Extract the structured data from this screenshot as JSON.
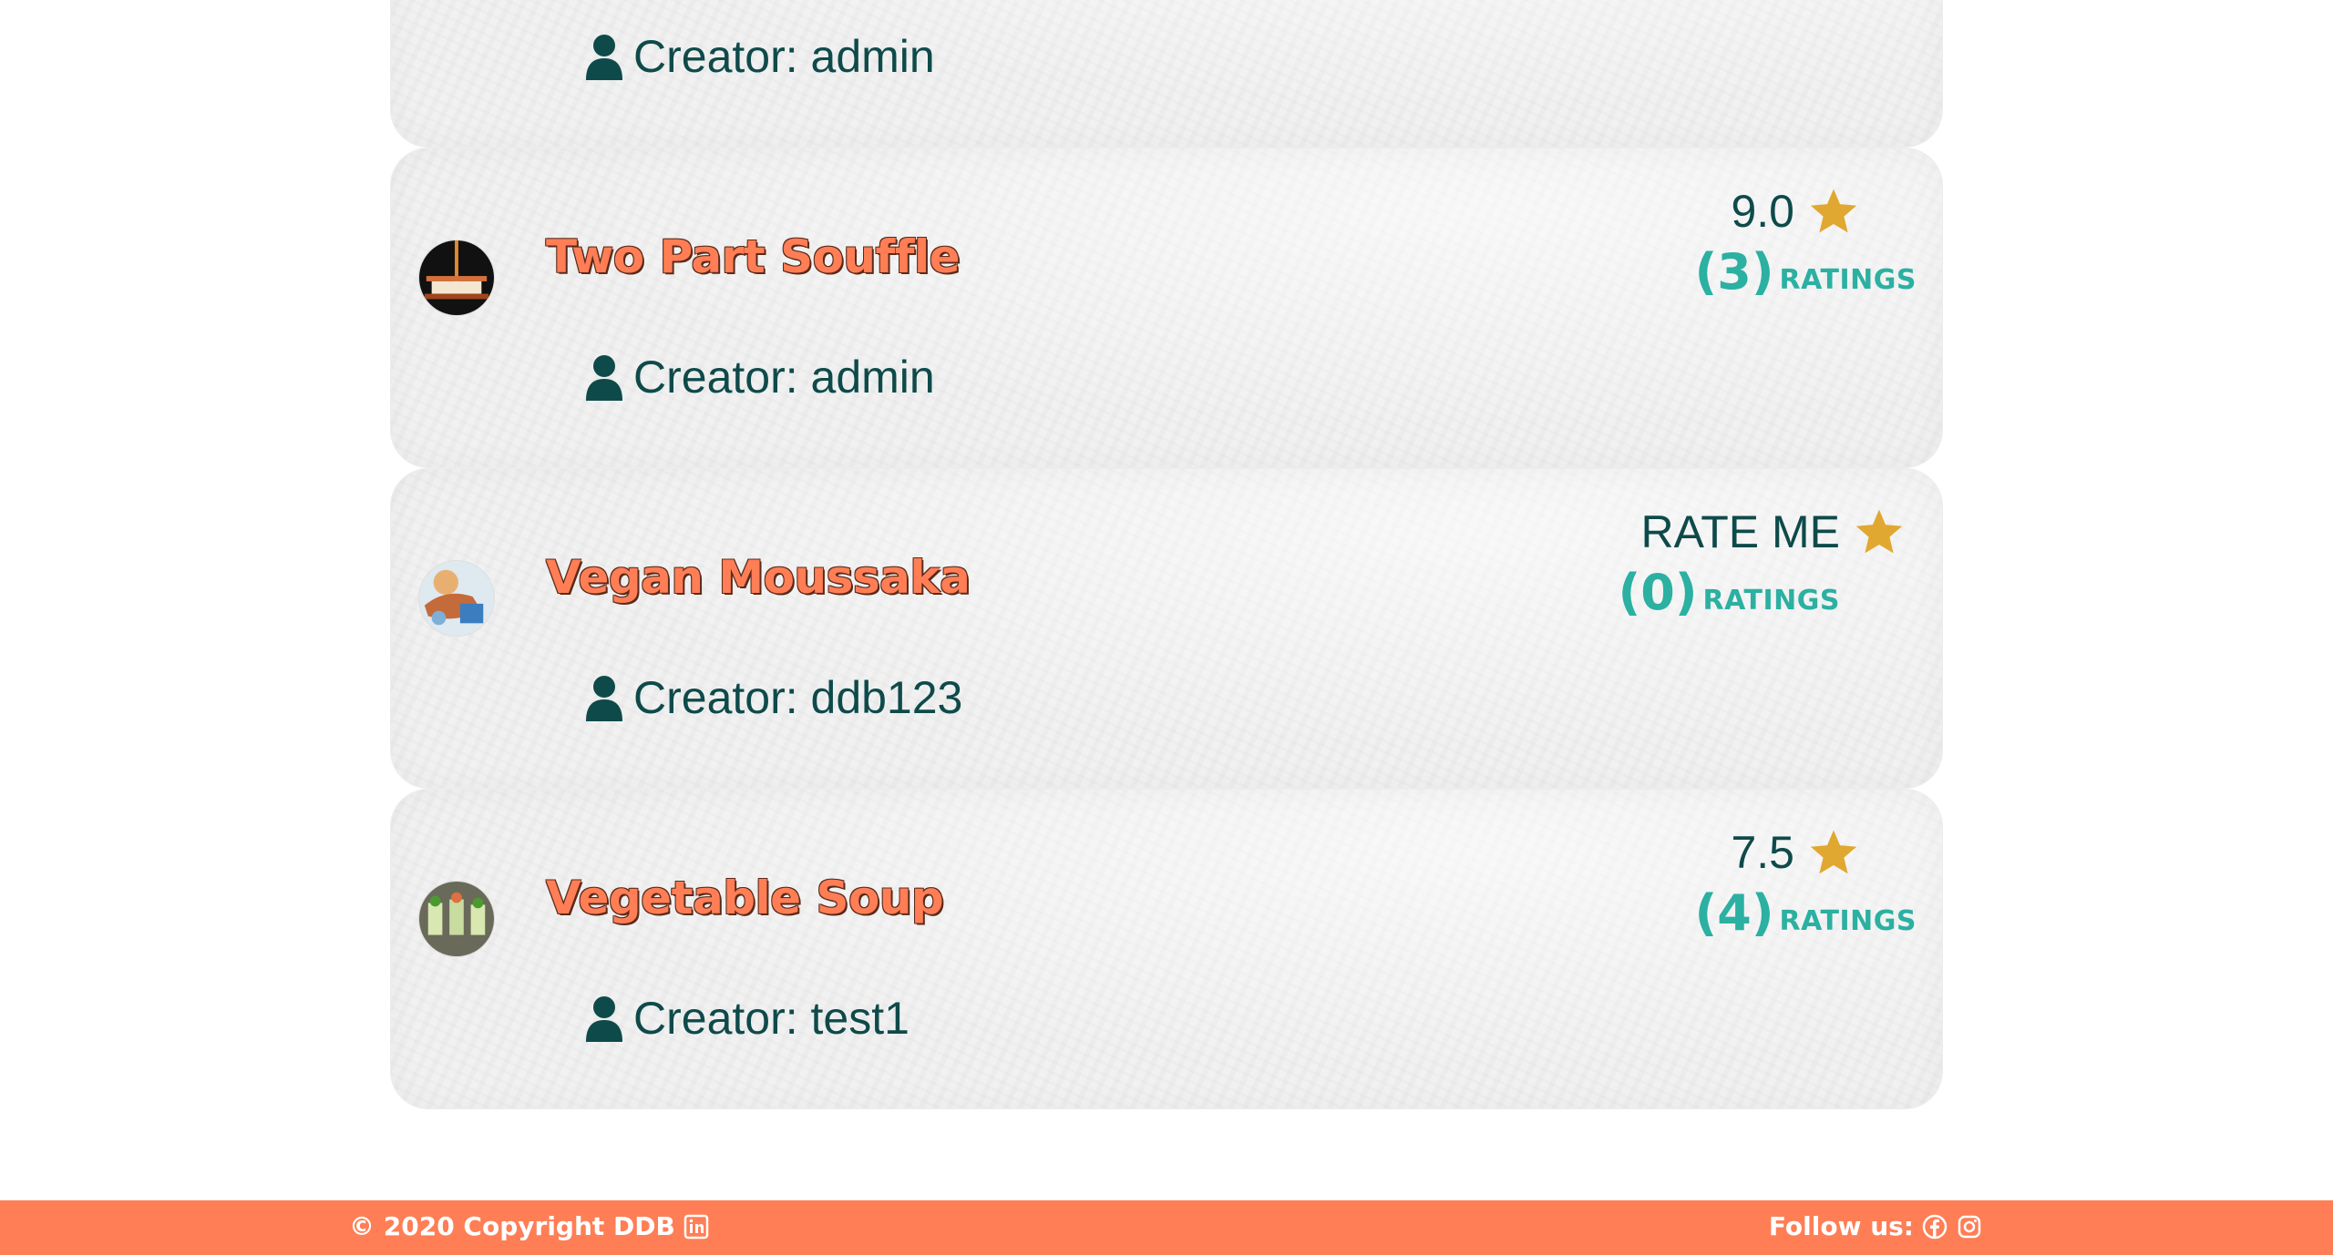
{
  "recipes": [
    {
      "title": "",
      "creator": "Creator: admin",
      "score": "",
      "count_num": "",
      "count_label": ""
    },
    {
      "title": "Two Part Souffle",
      "creator": "Creator: admin",
      "score": "9.0",
      "count_num": "(3)",
      "count_label": "RATINGS"
    },
    {
      "title": "Vegan Moussaka",
      "creator": "Creator: ddb123",
      "score": "RATE ME",
      "count_num": "(0)",
      "count_label": "RATINGS"
    },
    {
      "title": "Vegetable Soup",
      "creator": "Creator: test1",
      "score": "7.5",
      "count_num": "(4)",
      "count_label": "RATINGS"
    }
  ],
  "footer": {
    "copyright": "© 2020 Copyright DDB",
    "follow": "Follow us:"
  },
  "icons": {
    "user": "user-icon",
    "star": "star-icon",
    "linkedin": "linkedin-icon",
    "facebook": "facebook-icon",
    "instagram": "instagram-icon"
  },
  "colors": {
    "accent": "#ff7e55",
    "teal_dark": "#0f4a4a",
    "teal_light": "#2bb0a2",
    "star": "#e0a830"
  }
}
